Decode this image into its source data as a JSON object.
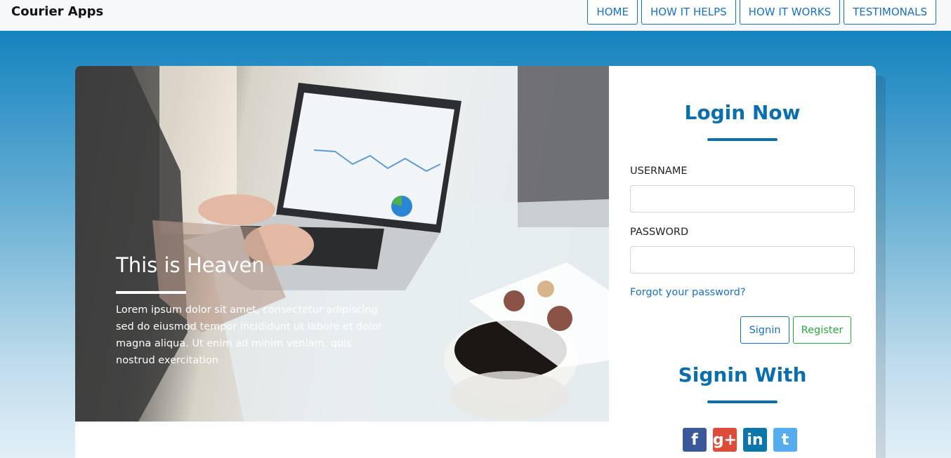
{
  "navbar": {
    "brand": "Courier Apps",
    "links": [
      "HOME",
      "HOW IT HELPS",
      "HOW IT WORKS",
      "TESTIMONALS"
    ]
  },
  "hero": {
    "title": "This is Heaven",
    "text": "Lorem ipsum dolor sit amet, consectetur adipiscing sed do eiusmod tempor incididunt ut labore et dolor magna aliqua. Ut enim ad minim veniam, quis nostrud exercitation"
  },
  "login": {
    "title": "Login Now",
    "username_label": "USERNAME",
    "username_value": "",
    "password_label": "PASSWORD",
    "password_value": "",
    "forgot_link": "Forgot your password?",
    "signin_button": "Signin",
    "register_button": "Register",
    "signin_with_title": "Signin With",
    "socials": [
      {
        "name": "facebook-icon",
        "glyph": "f",
        "color": "#3b5998"
      },
      {
        "name": "google-plus-icon",
        "glyph": "g+",
        "color": "#dd4b39"
      },
      {
        "name": "linkedin-icon",
        "glyph": "in",
        "color": "#0e76a8"
      },
      {
        "name": "twitter-icon",
        "glyph": "t",
        "color": "#55acee"
      }
    ]
  },
  "colors": {
    "accent": "#0b6fae",
    "link": "#1a6fc1",
    "register": "#28a745",
    "background_top": "#0a7cb8"
  }
}
